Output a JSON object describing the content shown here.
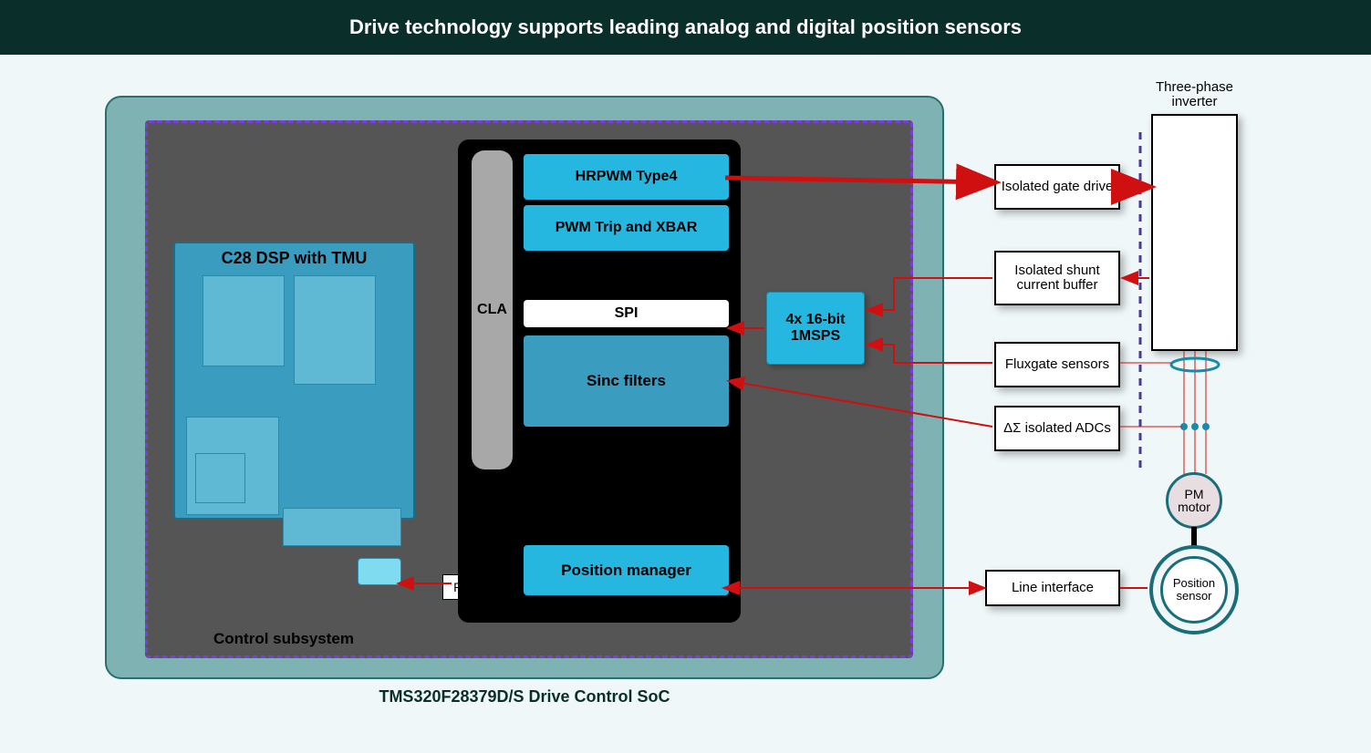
{
  "title": "Drive technology supports leading analog and digital position sensors",
  "soc_label": "TMS320F28379D/S Drive Control SoC",
  "control_subsystem_label": "Control subsystem",
  "dsp_label": "C28 DSP with TMU",
  "port_label": "Port",
  "cla_label": "CLA",
  "modules": {
    "hrpwm": "HRPWM Type4",
    "xbar": "PWM Trip and XBAR",
    "spi": "SPI",
    "sinc": "Sinc filters",
    "pos_mgr": "Position manager"
  },
  "adc_block": "4x 16-bit 1MSPS",
  "ext": {
    "gate_drive": "Isolated gate drive",
    "shunt_buffer": "Isolated shunt current buffer",
    "fluxgate": "Fluxgate sensors",
    "ds_adc": "ΔΣ isolated ADCs",
    "line_if": "Line interface"
  },
  "inverter_label": "Three-phase inverter",
  "pm_motor": "PM motor",
  "position_sensor": "Position sensor"
}
